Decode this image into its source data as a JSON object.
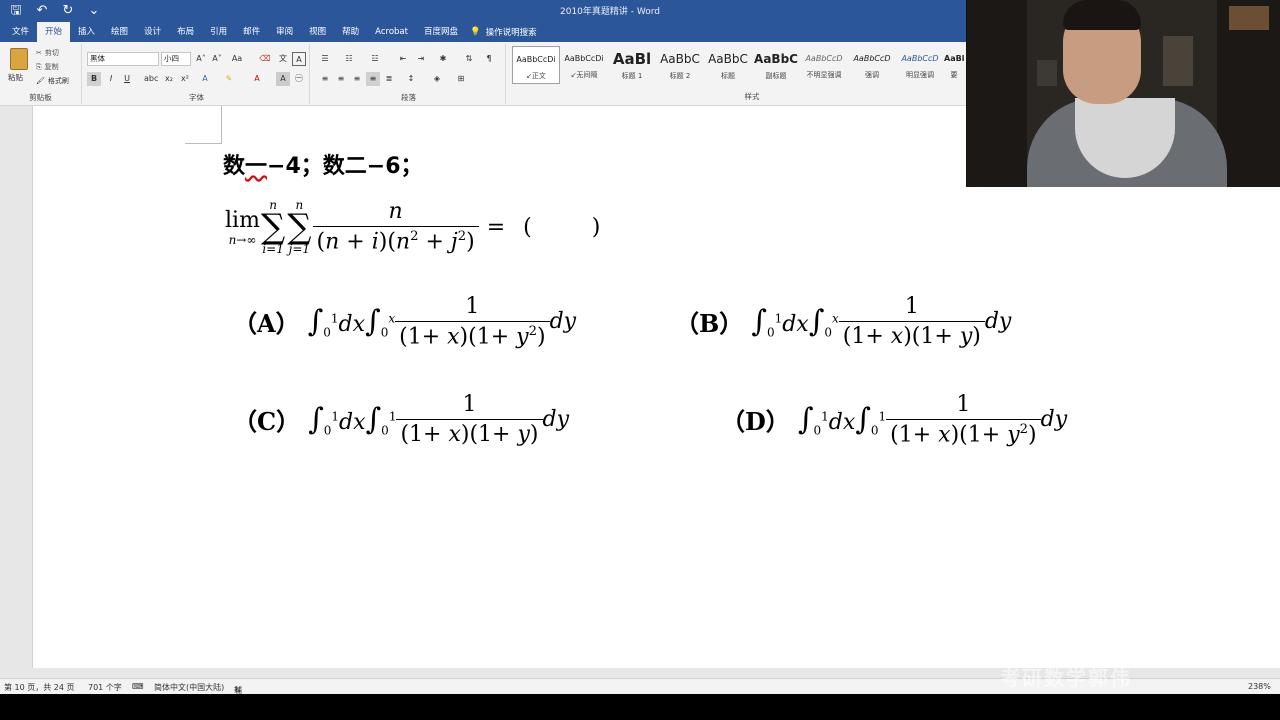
{
  "titlebar": {
    "doc_title": "2010年真题精讲  -  Word"
  },
  "tabs": [
    "文件",
    "开始",
    "插入",
    "绘图",
    "设计",
    "布局",
    "引用",
    "邮件",
    "审阅",
    "视图",
    "帮助",
    "Acrobat",
    "百度网盘"
  ],
  "tell_me": "操作说明搜索",
  "ribbon": {
    "clipboard": {
      "paste": "粘贴",
      "cut": "剪切",
      "copy": "复制",
      "format_painter": "格式刷",
      "label": "剪贴板"
    },
    "font": {
      "font_name": "黑体",
      "font_size": "小四",
      "label": "字体"
    },
    "paragraph": {
      "label": "段落"
    },
    "styles": {
      "label": "样式",
      "items": [
        {
          "preview": "AaBbCcDi",
          "name": "↙正文"
        },
        {
          "preview": "AaBbCcDi",
          "name": "↙无间隔"
        },
        {
          "preview": "AaBl",
          "name": "标题 1"
        },
        {
          "preview": "AaBbC",
          "name": "标题 2"
        },
        {
          "preview": "AaBbC",
          "name": "标题"
        },
        {
          "preview": "AaBbC",
          "name": "副标题"
        },
        {
          "preview": "AaBbCcD",
          "name": "不明显强调"
        },
        {
          "preview": "AaBbCcD",
          "name": "强调"
        },
        {
          "preview": "AaBbCcD",
          "name": "明显强调"
        },
        {
          "preview": "AaBl",
          "name": "要"
        }
      ]
    }
  },
  "document": {
    "heading_prefix": "数",
    "heading_wavy": "一",
    "heading_rest": "−4；数二−6；",
    "question": {
      "lim": "lim",
      "lim_sub": "n→∞",
      "sum_top": "n",
      "sum1_sub": "i=1",
      "sum2_sub": "j=1",
      "num": "n",
      "eq": "=",
      "paren_open": "(",
      "paren_close": ")"
    },
    "options": [
      {
        "label": "（A）",
        "outer": "∫₀¹ dx",
        "inner_upper": "x",
        "den_right": "(1+ y²)"
      },
      {
        "label": "（B）",
        "outer": "∫₀¹ dx",
        "inner_upper": "x",
        "den_right": "(1+ y)"
      },
      {
        "label": "（C）",
        "outer": "∫₀¹ dx",
        "inner_upper": "1",
        "den_right": "(1+ y)"
      },
      {
        "label": "（D）",
        "outer": "∫₀¹ dx",
        "inner_upper": "1",
        "den_right": "(1+ y²)"
      }
    ]
  },
  "statusbar": {
    "page": "第 10 页，共 24 页",
    "words": "701 个字",
    "language": "简体中文(中国大陆)",
    "accessibility": "辅助功能: 调查",
    "zoom": "238%"
  },
  "watermark": "考研数学郭伟"
}
